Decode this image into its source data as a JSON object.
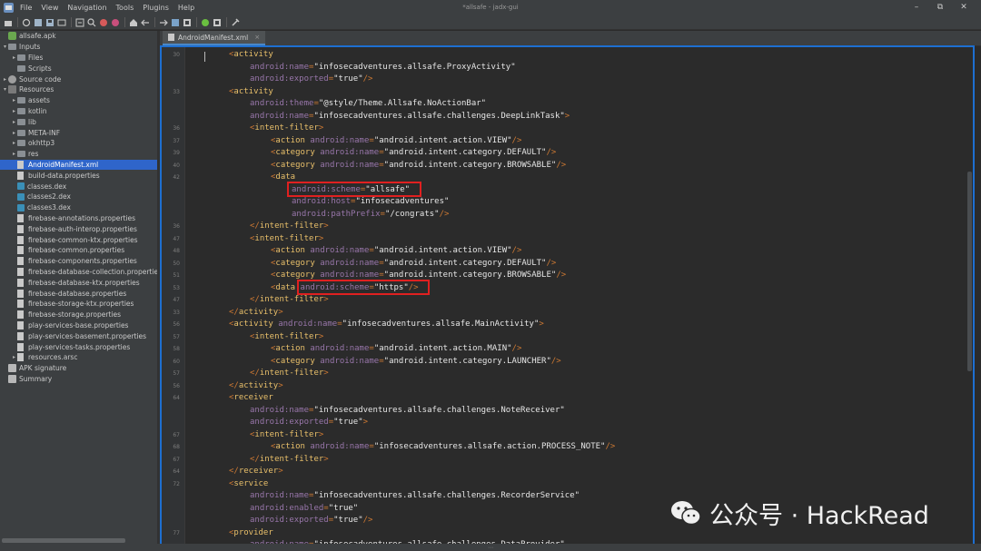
{
  "window": {
    "title": "*allsafe - jadx-gui",
    "menu": [
      "File",
      "View",
      "Navigation",
      "Tools",
      "Plugins",
      "Help"
    ],
    "controls": [
      "–",
      "⧉",
      "✕"
    ]
  },
  "toolbar": {
    "icons": [
      "open-file-icon",
      "sync-icon",
      "save-icon",
      "save-all-icon",
      "export-icon",
      "flatten-icon",
      "search-icon",
      "find-class-icon",
      "find-usage-icon",
      "home-icon",
      "back-icon",
      "forward-icon",
      "structure-icon",
      "deobfuscate-icon",
      "android-icon",
      "stop-icon",
      "preferences-icon"
    ]
  },
  "tree": {
    "items": [
      {
        "label": "allsafe.apk",
        "depth": 0,
        "arrow": "",
        "icon": "apk"
      },
      {
        "label": "Inputs",
        "depth": 0,
        "arrow": "▾",
        "icon": "folder"
      },
      {
        "label": "Files",
        "depth": 1,
        "arrow": "▸",
        "icon": "folder"
      },
      {
        "label": "Scripts",
        "depth": 1,
        "arrow": "",
        "icon": "folder"
      },
      {
        "label": "Source code",
        "depth": 0,
        "arrow": "▸",
        "icon": "code"
      },
      {
        "label": "Resources",
        "depth": 0,
        "arrow": "▾",
        "icon": "res"
      },
      {
        "label": "assets",
        "depth": 1,
        "arrow": "▸",
        "icon": "folder"
      },
      {
        "label": "kotlin",
        "depth": 1,
        "arrow": "▸",
        "icon": "folder"
      },
      {
        "label": "lib",
        "depth": 1,
        "arrow": "▸",
        "icon": "folder"
      },
      {
        "label": "META-INF",
        "depth": 1,
        "arrow": "▸",
        "icon": "folder"
      },
      {
        "label": "okhttp3",
        "depth": 1,
        "arrow": "▸",
        "icon": "folder"
      },
      {
        "label": "res",
        "depth": 1,
        "arrow": "▸",
        "icon": "folder"
      },
      {
        "label": "AndroidManifest.xml",
        "depth": 1,
        "arrow": "",
        "icon": "file",
        "selected": true
      },
      {
        "label": "build-data.properties",
        "depth": 1,
        "arrow": "",
        "icon": "file"
      },
      {
        "label": "classes.dex",
        "depth": 1,
        "arrow": "",
        "icon": "dex"
      },
      {
        "label": "classes2.dex",
        "depth": 1,
        "arrow": "",
        "icon": "dex"
      },
      {
        "label": "classes3.dex",
        "depth": 1,
        "arrow": "",
        "icon": "dex"
      },
      {
        "label": "firebase-annotations.properties",
        "depth": 1,
        "arrow": "",
        "icon": "file"
      },
      {
        "label": "firebase-auth-interop.properties",
        "depth": 1,
        "arrow": "",
        "icon": "file"
      },
      {
        "label": "firebase-common-ktx.properties",
        "depth": 1,
        "arrow": "",
        "icon": "file"
      },
      {
        "label": "firebase-common.properties",
        "depth": 1,
        "arrow": "",
        "icon": "file"
      },
      {
        "label": "firebase-components.properties",
        "depth": 1,
        "arrow": "",
        "icon": "file"
      },
      {
        "label": "firebase-database-collection.properties",
        "depth": 1,
        "arrow": "",
        "icon": "file"
      },
      {
        "label": "firebase-database-ktx.properties",
        "depth": 1,
        "arrow": "",
        "icon": "file"
      },
      {
        "label": "firebase-database.properties",
        "depth": 1,
        "arrow": "",
        "icon": "file"
      },
      {
        "label": "firebase-storage-ktx.properties",
        "depth": 1,
        "arrow": "",
        "icon": "file"
      },
      {
        "label": "firebase-storage.properties",
        "depth": 1,
        "arrow": "",
        "icon": "file"
      },
      {
        "label": "play-services-base.properties",
        "depth": 1,
        "arrow": "",
        "icon": "file"
      },
      {
        "label": "play-services-basement.properties",
        "depth": 1,
        "arrow": "",
        "icon": "file"
      },
      {
        "label": "play-services-tasks.properties",
        "depth": 1,
        "arrow": "",
        "icon": "file"
      },
      {
        "label": "resources.arsc",
        "depth": 1,
        "arrow": "▸",
        "icon": "file"
      },
      {
        "label": "APK signature",
        "depth": 0,
        "arrow": "",
        "icon": "sig"
      },
      {
        "label": "Summary",
        "depth": 0,
        "arrow": "",
        "icon": "sig"
      }
    ]
  },
  "editor": {
    "tab_label": "AndroidManifest.xml",
    "tab_close": "×",
    "lines": [
      {
        "num": "30",
        "indent": 0,
        "parts": [
          [
            "p",
            "<"
          ],
          [
            "t",
            "activity"
          ]
        ]
      },
      {
        "num": "",
        "indent": 1,
        "parts": [
          [
            "a",
            "android:name"
          ],
          [
            "p",
            "="
          ],
          [
            "v",
            "\"infosecadventures.allsafe.ProxyActivity\""
          ]
        ]
      },
      {
        "num": "",
        "indent": 1,
        "parts": [
          [
            "a",
            "android:exported"
          ],
          [
            "p",
            "="
          ],
          [
            "v",
            "\"true\""
          ],
          [
            "p",
            "/>"
          ]
        ]
      },
      {
        "num": "33",
        "indent": 0,
        "parts": [
          [
            "p",
            "<"
          ],
          [
            "t",
            "activity"
          ]
        ]
      },
      {
        "num": "",
        "indent": 1,
        "parts": [
          [
            "a",
            "android:theme"
          ],
          [
            "p",
            "="
          ],
          [
            "v",
            "\"@style/Theme.Allsafe.NoActionBar\""
          ]
        ]
      },
      {
        "num": "",
        "indent": 1,
        "parts": [
          [
            "a",
            "android:name"
          ],
          [
            "p",
            "="
          ],
          [
            "v",
            "\"infosecadventures.allsafe.challenges.DeepLinkTask\""
          ],
          [
            "p",
            ">"
          ]
        ]
      },
      {
        "num": "36",
        "indent": 1,
        "parts": [
          [
            "p",
            "<"
          ],
          [
            "t",
            "intent-filter"
          ],
          [
            "p",
            ">"
          ]
        ]
      },
      {
        "num": "37",
        "indent": 2,
        "parts": [
          [
            "p",
            "<"
          ],
          [
            "t",
            "action"
          ],
          [
            "s",
            " "
          ],
          [
            "a",
            "android:name"
          ],
          [
            "p",
            "="
          ],
          [
            "v",
            "\"android.intent.action.VIEW\""
          ],
          [
            "p",
            "/>"
          ]
        ]
      },
      {
        "num": "39",
        "indent": 2,
        "parts": [
          [
            "p",
            "<"
          ],
          [
            "t",
            "category"
          ],
          [
            "s",
            " "
          ],
          [
            "a",
            "android:name"
          ],
          [
            "p",
            "="
          ],
          [
            "v",
            "\"android.intent.category.DEFAULT\""
          ],
          [
            "p",
            "/>"
          ]
        ]
      },
      {
        "num": "40",
        "indent": 2,
        "parts": [
          [
            "p",
            "<"
          ],
          [
            "t",
            "category"
          ],
          [
            "s",
            " "
          ],
          [
            "a",
            "android:name"
          ],
          [
            "p",
            "="
          ],
          [
            "v",
            "\"android.intent.category.BROWSABLE\""
          ],
          [
            "p",
            "/>"
          ]
        ]
      },
      {
        "num": "42",
        "indent": 2,
        "parts": [
          [
            "p",
            "<"
          ],
          [
            "t",
            "data"
          ]
        ]
      },
      {
        "num": "",
        "indent": 3,
        "parts": [
          [
            "a",
            "android:scheme"
          ],
          [
            "p",
            "="
          ],
          [
            "v",
            "\"allsafe\""
          ]
        ]
      },
      {
        "num": "",
        "indent": 3,
        "parts": [
          [
            "a",
            "android:host"
          ],
          [
            "p",
            "="
          ],
          [
            "v",
            "\"infosecadventures\""
          ]
        ]
      },
      {
        "num": "",
        "indent": 3,
        "parts": [
          [
            "a",
            "android:pathPrefix"
          ],
          [
            "p",
            "="
          ],
          [
            "v",
            "\"/congrats\""
          ],
          [
            "p",
            "/>"
          ]
        ]
      },
      {
        "num": "36",
        "indent": 1,
        "parts": [
          [
            "p",
            "</"
          ],
          [
            "t",
            "intent-filter"
          ],
          [
            "p",
            ">"
          ]
        ]
      },
      {
        "num": "47",
        "indent": 1,
        "parts": [
          [
            "p",
            "<"
          ],
          [
            "t",
            "intent-filter"
          ],
          [
            "p",
            ">"
          ]
        ]
      },
      {
        "num": "48",
        "indent": 2,
        "parts": [
          [
            "p",
            "<"
          ],
          [
            "t",
            "action"
          ],
          [
            "s",
            " "
          ],
          [
            "a",
            "android:name"
          ],
          [
            "p",
            "="
          ],
          [
            "v",
            "\"android.intent.action.VIEW\""
          ],
          [
            "p",
            "/>"
          ]
        ]
      },
      {
        "num": "50",
        "indent": 2,
        "parts": [
          [
            "p",
            "<"
          ],
          [
            "t",
            "category"
          ],
          [
            "s",
            " "
          ],
          [
            "a",
            "android:name"
          ],
          [
            "p",
            "="
          ],
          [
            "v",
            "\"android.intent.category.DEFAULT\""
          ],
          [
            "p",
            "/>"
          ]
        ]
      },
      {
        "num": "51",
        "indent": 2,
        "parts": [
          [
            "p",
            "<"
          ],
          [
            "t",
            "category"
          ],
          [
            "s",
            " "
          ],
          [
            "a",
            "android:name"
          ],
          [
            "p",
            "="
          ],
          [
            "v",
            "\"android.intent.category.BROWSABLE\""
          ],
          [
            "p",
            "/>"
          ]
        ]
      },
      {
        "num": "53",
        "indent": 2,
        "parts": [
          [
            "p",
            "<"
          ],
          [
            "t",
            "data"
          ],
          [
            "s",
            " "
          ],
          [
            "a",
            "android:scheme"
          ],
          [
            "p",
            "="
          ],
          [
            "v",
            "\"https\""
          ],
          [
            "p",
            "/>"
          ]
        ]
      },
      {
        "num": "47",
        "indent": 1,
        "parts": [
          [
            "p",
            "</"
          ],
          [
            "t",
            "intent-filter"
          ],
          [
            "p",
            ">"
          ]
        ]
      },
      {
        "num": "33",
        "indent": 0,
        "parts": [
          [
            "p",
            "</"
          ],
          [
            "t",
            "activity"
          ],
          [
            "p",
            ">"
          ]
        ]
      },
      {
        "num": "56",
        "indent": 0,
        "parts": [
          [
            "p",
            "<"
          ],
          [
            "t",
            "activity"
          ],
          [
            "s",
            " "
          ],
          [
            "a",
            "android:name"
          ],
          [
            "p",
            "="
          ],
          [
            "v",
            "\"infosecadventures.allsafe.MainActivity\""
          ],
          [
            "p",
            ">"
          ]
        ]
      },
      {
        "num": "57",
        "indent": 1,
        "parts": [
          [
            "p",
            "<"
          ],
          [
            "t",
            "intent-filter"
          ],
          [
            "p",
            ">"
          ]
        ]
      },
      {
        "num": "58",
        "indent": 2,
        "parts": [
          [
            "p",
            "<"
          ],
          [
            "t",
            "action"
          ],
          [
            "s",
            " "
          ],
          [
            "a",
            "android:name"
          ],
          [
            "p",
            "="
          ],
          [
            "v",
            "\"android.intent.action.MAIN\""
          ],
          [
            "p",
            "/>"
          ]
        ]
      },
      {
        "num": "60",
        "indent": 2,
        "parts": [
          [
            "p",
            "<"
          ],
          [
            "t",
            "category"
          ],
          [
            "s",
            " "
          ],
          [
            "a",
            "android:name"
          ],
          [
            "p",
            "="
          ],
          [
            "v",
            "\"android.intent.category.LAUNCHER\""
          ],
          [
            "p",
            "/>"
          ]
        ]
      },
      {
        "num": "57",
        "indent": 1,
        "parts": [
          [
            "p",
            "</"
          ],
          [
            "t",
            "intent-filter"
          ],
          [
            "p",
            ">"
          ]
        ]
      },
      {
        "num": "56",
        "indent": 0,
        "parts": [
          [
            "p",
            "</"
          ],
          [
            "t",
            "activity"
          ],
          [
            "p",
            ">"
          ]
        ]
      },
      {
        "num": "64",
        "indent": 0,
        "parts": [
          [
            "p",
            "<"
          ],
          [
            "t",
            "receiver"
          ]
        ]
      },
      {
        "num": "",
        "indent": 1,
        "parts": [
          [
            "a",
            "android:name"
          ],
          [
            "p",
            "="
          ],
          [
            "v",
            "\"infosecadventures.allsafe.challenges.NoteReceiver\""
          ]
        ]
      },
      {
        "num": "",
        "indent": 1,
        "parts": [
          [
            "a",
            "android:exported"
          ],
          [
            "p",
            "="
          ],
          [
            "v",
            "\"true\""
          ],
          [
            "p",
            ">"
          ]
        ]
      },
      {
        "num": "67",
        "indent": 1,
        "parts": [
          [
            "p",
            "<"
          ],
          [
            "t",
            "intent-filter"
          ],
          [
            "p",
            ">"
          ]
        ]
      },
      {
        "num": "68",
        "indent": 2,
        "parts": [
          [
            "p",
            "<"
          ],
          [
            "t",
            "action"
          ],
          [
            "s",
            " "
          ],
          [
            "a",
            "android:name"
          ],
          [
            "p",
            "="
          ],
          [
            "v",
            "\"infosecadventures.allsafe.action.PROCESS_NOTE\""
          ],
          [
            "p",
            "/>"
          ]
        ]
      },
      {
        "num": "67",
        "indent": 1,
        "parts": [
          [
            "p",
            "</"
          ],
          [
            "t",
            "intent-filter"
          ],
          [
            "p",
            ">"
          ]
        ]
      },
      {
        "num": "64",
        "indent": 0,
        "parts": [
          [
            "p",
            "</"
          ],
          [
            "t",
            "receiver"
          ],
          [
            "p",
            ">"
          ]
        ]
      },
      {
        "num": "72",
        "indent": 0,
        "parts": [
          [
            "p",
            "<"
          ],
          [
            "t",
            "service"
          ]
        ]
      },
      {
        "num": "",
        "indent": 1,
        "parts": [
          [
            "a",
            "android:name"
          ],
          [
            "p",
            "="
          ],
          [
            "v",
            "\"infosecadventures.allsafe.challenges.RecorderService\""
          ]
        ]
      },
      {
        "num": "",
        "indent": 1,
        "parts": [
          [
            "a",
            "android:enabled"
          ],
          [
            "p",
            "="
          ],
          [
            "v",
            "\"true\""
          ]
        ]
      },
      {
        "num": "",
        "indent": 1,
        "parts": [
          [
            "a",
            "android:exported"
          ],
          [
            "p",
            "="
          ],
          [
            "v",
            "\"true\""
          ],
          [
            "p",
            "/>"
          ]
        ]
      },
      {
        "num": "77",
        "indent": 0,
        "parts": [
          [
            "p",
            "<"
          ],
          [
            "t",
            "provider"
          ]
        ]
      },
      {
        "num": "",
        "indent": 1,
        "parts": [
          [
            "a",
            "android:name"
          ],
          [
            "p",
            "="
          ],
          [
            "v",
            "\"infosecadventures.allsafe.challenges.DataProvider\""
          ]
        ]
      }
    ]
  },
  "watermark": {
    "text": "公众号 · HackRead"
  },
  "colors": {
    "tag": "#e8bf6a",
    "attribute": "#9876aa",
    "value": "#e6e6e6",
    "punctuation": "#cc7832",
    "highlight_box": "#e02020",
    "selection": "#2f65ca"
  }
}
